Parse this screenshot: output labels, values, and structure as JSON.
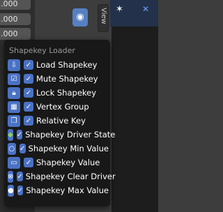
{
  "background": {
    "fields": [
      ".000",
      ".000",
      ".000",
      ".000"
    ],
    "view_tab": "View"
  },
  "popup": {
    "title": "Shapekey Loader",
    "items": [
      {
        "label": "Load Shapekey",
        "checked": true,
        "icon": "import-icon"
      },
      {
        "label": "Mute Shapekey",
        "checked": true,
        "icon": "checkbox-icon"
      },
      {
        "label": "Lock Shapekey",
        "checked": true,
        "icon": "lock-icon"
      },
      {
        "label": "Vertex Group",
        "checked": true,
        "icon": "vertex-group-icon"
      },
      {
        "label": "Relative Key",
        "checked": true,
        "icon": "relative-key-icon"
      },
      {
        "label": "Shapekey Driver State",
        "checked": true,
        "icon": "driver-diamond-icon"
      },
      {
        "label": "Shapekey Min Value",
        "checked": true,
        "icon": "circle-outline-icon"
      },
      {
        "label": "Shapekey Value",
        "checked": true,
        "icon": "value-bar-icon"
      },
      {
        "label": "Shapekey Clear Driver",
        "checked": true,
        "icon": "clear-x-icon"
      },
      {
        "label": "Shapekey Max Value",
        "checked": true,
        "icon": "circle-filled-icon"
      }
    ]
  },
  "colors": {
    "accent": "#4a72c4",
    "popup_bg": "#181818"
  }
}
